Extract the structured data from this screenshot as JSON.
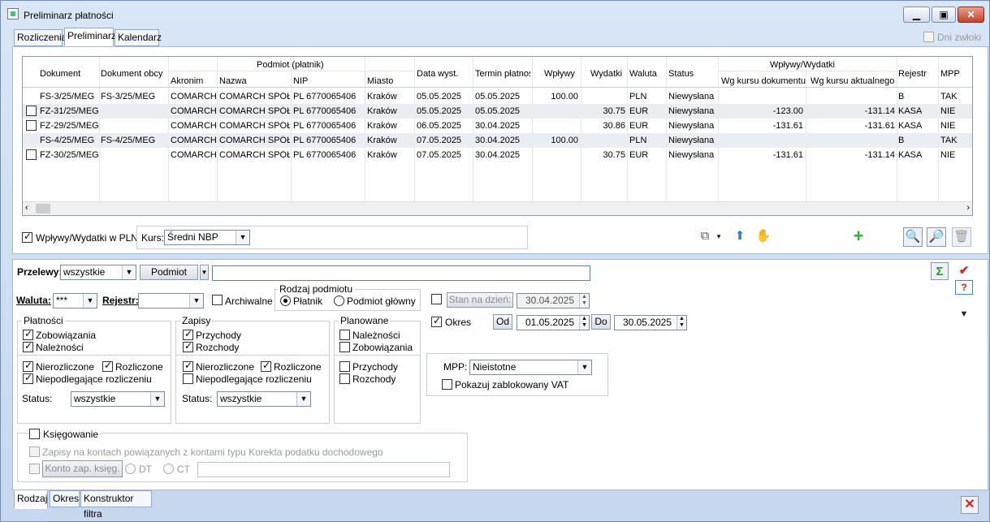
{
  "window": {
    "title": "Preliminarz płatności"
  },
  "top_tabs": [
    "Rozliczenia",
    "Preliminarz",
    "Kalendarz"
  ],
  "dni_zwloki": "Dni zwłoki",
  "grid": {
    "headers": {
      "dokument": "Dokument",
      "dokument_obcy": "Dokument obcy",
      "podmiot": "Podmiot (płatnik)",
      "akronim": "Akronim",
      "nazwa": "Nazwa",
      "nip": "NIP",
      "miasto": "Miasto",
      "data_wyst": "Data wyst.",
      "termin": "Termin płatnoś",
      "wplywy": "Wpływy",
      "wydatki": "Wydatki",
      "waluta": "Waluta",
      "status": "Status",
      "wplywy_wydatki": "Wpływy/Wydatki",
      "wg_dok": "Wg kursu dokumentu",
      "wg_akt": "Wg kursu aktualnego",
      "rejestr": "Rejestr",
      "mpp": "MPP"
    },
    "rows": [
      {
        "check": false,
        "dokument": "FS-3/25/MEG",
        "obcy": "FS-3/25/MEG",
        "akronim": "COMARCH",
        "nazwa": "COMARCH SPÓŁK",
        "nip": "PL 6770065406",
        "miasto": "Kraków",
        "data": "05.05.2025",
        "termin": "05.05.2025",
        "wplywy": "100.00",
        "wydatki": "",
        "waluta": "PLN",
        "status": "Niewysłana",
        "wg_dok": "",
        "wg_akt": "",
        "rejestr": "B",
        "mpp": "TAK"
      },
      {
        "check": true,
        "dokument": "FZ-31/25/MEG",
        "obcy": "",
        "akronim": "COMARCH",
        "nazwa": "COMARCH SPÓŁK",
        "nip": "PL 6770065406",
        "miasto": "Kraków",
        "data": "05.05.2025",
        "termin": "05.05.2025",
        "wplywy": "",
        "wydatki": "30.75",
        "waluta": "EUR",
        "status": "Niewysłana",
        "wg_dok": "-123.00",
        "wg_akt": "-131.14",
        "rejestr": "KASA",
        "mpp": "NIE"
      },
      {
        "check": true,
        "dokument": "FZ-29/25/MEG",
        "obcy": "",
        "akronim": "COMARCH",
        "nazwa": "COMARCH SPÓŁK",
        "nip": "PL 6770065406",
        "miasto": "Kraków",
        "data": "06.05.2025",
        "termin": "30.04.2025",
        "wplywy": "",
        "wydatki": "30.86",
        "waluta": "EUR",
        "status": "Niewysłana",
        "wg_dok": "-131.61",
        "wg_akt": "-131.61",
        "rejestr": "KASA",
        "mpp": "NIE"
      },
      {
        "check": false,
        "dokument": "FS-4/25/MEG",
        "obcy": "FS-4/25/MEG",
        "akronim": "COMARCH",
        "nazwa": "COMARCH SPÓŁK",
        "nip": "PL 6770065406",
        "miasto": "Kraków",
        "data": "07.05.2025",
        "termin": "30.04.2025",
        "wplywy": "100.00",
        "wydatki": "",
        "waluta": "PLN",
        "status": "Niewysłana",
        "wg_dok": "",
        "wg_akt": "",
        "rejestr": "B",
        "mpp": "TAK"
      },
      {
        "check": true,
        "dokument": "FZ-30/25/MEG",
        "obcy": "",
        "akronim": "COMARCH",
        "nazwa": "COMARCH SPÓŁK",
        "nip": "PL 6770065406",
        "miasto": "Kraków",
        "data": "07.05.2025",
        "termin": "30.04.2025",
        "wplywy": "",
        "wydatki": "30.75",
        "waluta": "EUR",
        "status": "Niewysłana",
        "wg_dok": "-131.61",
        "wg_akt": "-131.14",
        "rejestr": "KASA",
        "mpp": "NIE"
      }
    ]
  },
  "pln_checkbox": "Wpływy/Wydatki w PLN",
  "kurs": {
    "label": "Kurs:",
    "value": "Średni NBP"
  },
  "filter": {
    "przelewy_label": "Przelewy:",
    "przelewy_value": "wszystkie",
    "podmiot_button": "Podmiot",
    "waluta_label": "Waluta:",
    "waluta_value": "***",
    "rejestr_label": "Rejestr:",
    "archiwalne": "Archiwalne",
    "rodzaj_podmiotu": "Rodzaj podmiotu",
    "platnik": "Płatnik",
    "podmiot_glowny": "Podmiot główny",
    "stan_na_dzien": "Stan na dzień:",
    "stan_date": "30.04.2025",
    "okres": "Okres",
    "od": "Od",
    "od_date": "01.05.2025",
    "do": "Do",
    "do_date": "30.05.2025",
    "platnosci": "Płatności",
    "zobowiazania": "Zobowiązania",
    "naleznosci": "Należności",
    "nierozliczone": "Nierozliczone",
    "rozliczone": "Rozliczone",
    "niepodlegajace": "Niepodlegające rozliczeniu",
    "status_label": "Status:",
    "status_value": "wszystkie",
    "zapisy": "Zapisy",
    "przychody": "Przychody",
    "rozchody": "Rozchody",
    "planowane": "Planowane",
    "mpp_label": "MPP:",
    "mpp_value": "Nieistotne",
    "pokazuj_vat": "Pokazuj zablokowany VAT",
    "ksiegowanie": "Księgowanie",
    "zapisy_na_kontach": "Zapisy na kontach powiązanych z kontami typu Korekta podatku dochodowego",
    "konto_button": "Konto zap. księg.",
    "dt": "DT",
    "ct": "CT"
  },
  "bottom_tabs": [
    "Rodzaj",
    "Okres",
    "Konstruktor filtra"
  ]
}
